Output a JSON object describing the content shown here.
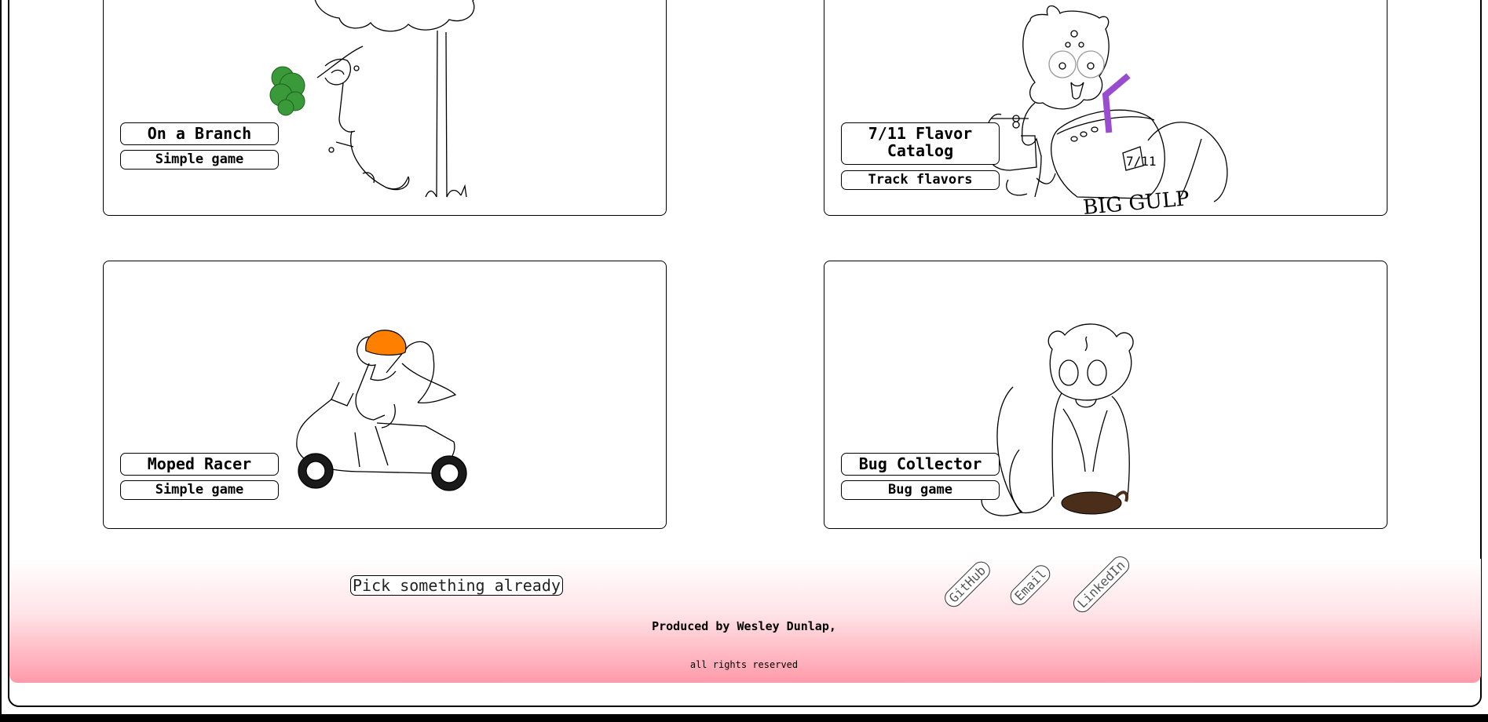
{
  "cards": [
    {
      "title": "On a Branch",
      "subtitle": "Simple game",
      "illustration": "cat-in-tree"
    },
    {
      "title": "7/11 Flavor Catalog",
      "subtitle": "Track flavors",
      "illustration": "cat-with-big-gulp",
      "cup_text": "7/11",
      "cup_text_2": "BIG GULP"
    },
    {
      "title": "Moped Racer",
      "subtitle": "Simple game",
      "illustration": "cat-on-moped"
    },
    {
      "title": "Bug Collector",
      "subtitle": "Bug game",
      "illustration": "cat-with-beetle"
    }
  ],
  "footer": {
    "pick_label": "Pick something already",
    "links": [
      "GitHub",
      "Email",
      "LinkedIn"
    ],
    "credit": "Produced by Wesley Dunlap,",
    "rights": "all rights reserved"
  },
  "colors": {
    "footer_gradient_end": "#ff9aa9",
    "helmet": "#ff7f00",
    "straw": "#9a4ccf",
    "leaves": "#3a9a3a",
    "beetle": "#4a2e1a"
  }
}
